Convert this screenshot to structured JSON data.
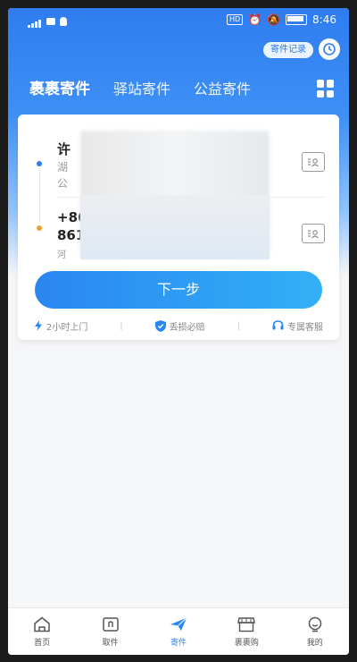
{
  "status_bar": {
    "time": "8:46",
    "hd_badge": "HD"
  },
  "header": {
    "records_label": "寄件记录"
  },
  "tabs": [
    {
      "label": "裹裹寄件",
      "active": true
    },
    {
      "label": "驿站寄件",
      "active": false
    },
    {
      "label": "公益寄件",
      "active": false
    }
  ],
  "sender": {
    "name_partial": "许",
    "addr_line1": "湖",
    "addr_line2": "公"
  },
  "receiver": {
    "phone_line1": "+86",
    "phone_line2": "861",
    "addr_line": "河"
  },
  "next_button": {
    "label": "下一步"
  },
  "features": [
    {
      "icon": "lightning-icon",
      "label": "2小时上门"
    },
    {
      "icon": "shield-icon",
      "label": "丢损必赔"
    },
    {
      "icon": "headset-icon",
      "label": "专属客服"
    }
  ],
  "bottom_nav": [
    {
      "icon": "home-icon",
      "label": "首页",
      "active": false
    },
    {
      "icon": "pickup-icon",
      "label": "取件",
      "active": false
    },
    {
      "icon": "send-icon",
      "label": "寄件",
      "active": true
    },
    {
      "icon": "store-icon",
      "label": "裹裹购",
      "active": false
    },
    {
      "icon": "profile-icon",
      "label": "我的",
      "active": false
    }
  ],
  "colors": {
    "primary": "#2f7cf0",
    "accent_orange": "#f0a030",
    "sender_dot": "#2f7cf0"
  }
}
